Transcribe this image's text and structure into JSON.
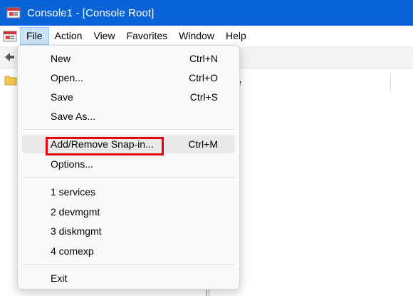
{
  "window": {
    "title": "Console1 - [Console Root]"
  },
  "menubar": {
    "items": [
      "File",
      "Action",
      "View",
      "Favorites",
      "Window",
      "Help"
    ]
  },
  "background": {
    "column_header_fragment": "e"
  },
  "file_menu": {
    "groups": [
      [
        {
          "label": "New",
          "shortcut": "Ctrl+N"
        },
        {
          "label": "Open...",
          "shortcut": "Ctrl+O"
        },
        {
          "label": "Save",
          "shortcut": "Ctrl+S"
        },
        {
          "label": "Save As...",
          "shortcut": ""
        }
      ],
      [
        {
          "label": "Add/Remove Snap-in...",
          "shortcut": "Ctrl+M"
        },
        {
          "label": "Options...",
          "shortcut": ""
        }
      ],
      [
        {
          "label": "1 services",
          "shortcut": ""
        },
        {
          "label": "2 devmgmt",
          "shortcut": ""
        },
        {
          "label": "3 diskmgmt",
          "shortcut": ""
        },
        {
          "label": "4 comexp",
          "shortcut": ""
        }
      ],
      [
        {
          "label": "Exit",
          "shortcut": ""
        }
      ]
    ]
  },
  "colors": {
    "titlebar": "#0a64d8",
    "highlight_border": "#e8000b",
    "hover": "#e9e9e9"
  }
}
